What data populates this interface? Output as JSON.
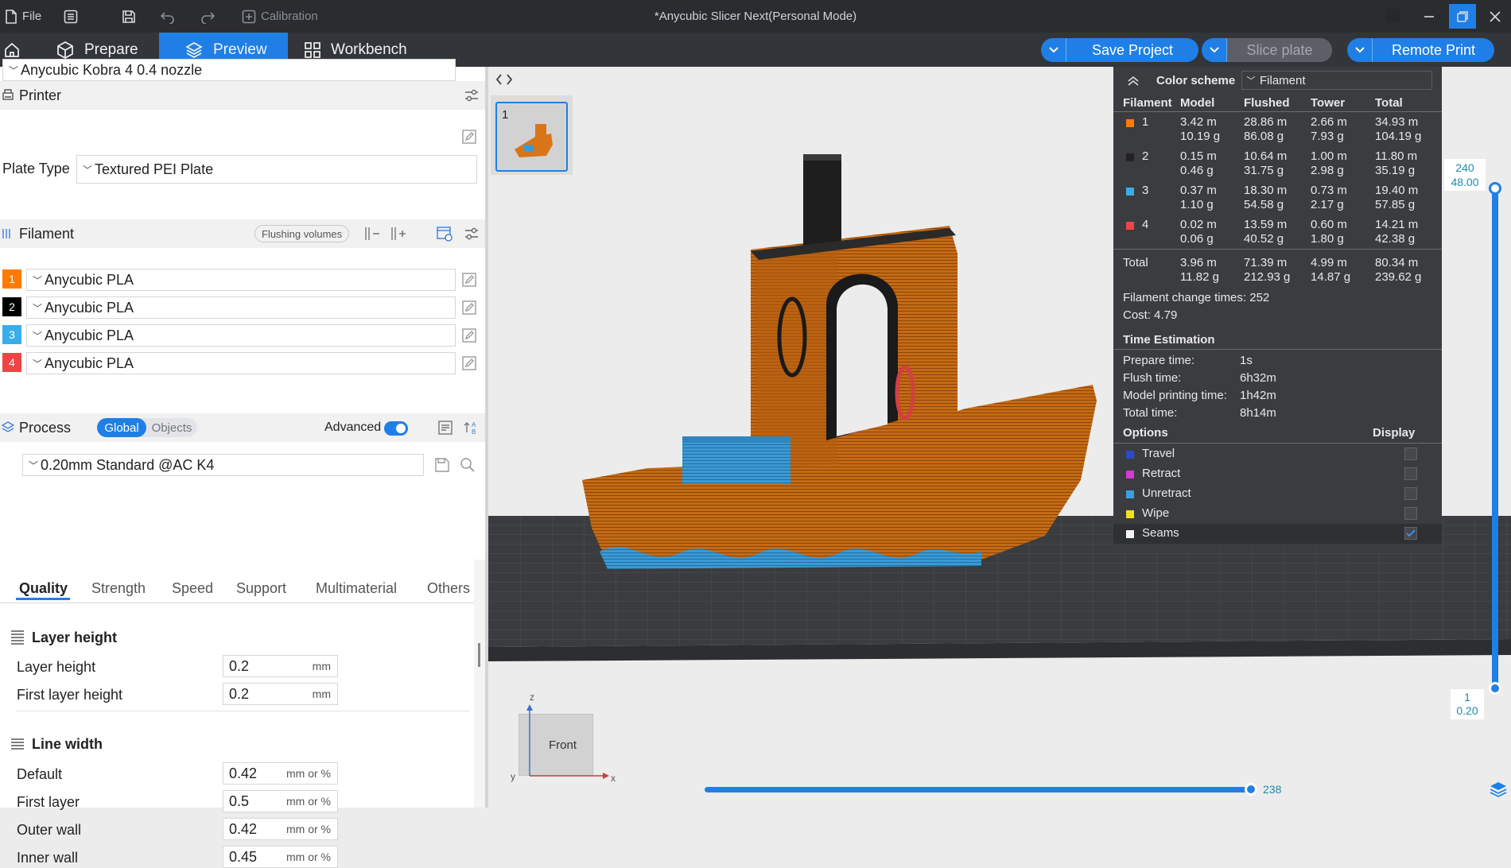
{
  "titlebar": {
    "file_label": "File",
    "calibration_label": "Calibration",
    "window_title": "*Anycubic Slicer Next(Personal Mode)"
  },
  "tabs": {
    "prepare": "Prepare",
    "preview": "Preview",
    "workbench": "Workbench",
    "save_project": "Save Project",
    "slice_plate": "Slice plate",
    "remote_print": "Remote Print"
  },
  "printer": {
    "section_title": "Printer",
    "printer_name": "Anycubic Kobra 4 0.4 nozzle",
    "plate_type_label": "Plate Type",
    "plate_type_value": "Textured PEI Plate"
  },
  "filament": {
    "section_title": "Filament",
    "flushing_volumes": "Flushing volumes",
    "items": [
      {
        "num": "1",
        "name": "Anycubic PLA",
        "color": "#ff7a00"
      },
      {
        "num": "2",
        "name": "Anycubic PLA",
        "color": "#000000"
      },
      {
        "num": "3",
        "name": "Anycubic PLA",
        "color": "#3aaee8"
      },
      {
        "num": "4",
        "name": "Anycubic PLA",
        "color": "#f04444"
      }
    ]
  },
  "process": {
    "section_title": "Process",
    "global_label": "Global",
    "objects_label": "Objects",
    "advanced_label": "Advanced",
    "profile": "0.20mm Standard @AC K4",
    "subtabs": [
      "Quality",
      "Strength",
      "Speed",
      "Support",
      "Multimaterial",
      "Others"
    ],
    "layer_height_group": "Layer height",
    "layer_height_label": "Layer height",
    "layer_height_value": "0.2",
    "first_layer_height_label": "First layer height",
    "first_layer_height_value": "0.2",
    "unit_mm": "mm",
    "line_width_group": "Line width",
    "unit_mm_or_pct": "mm or %",
    "line_widths": [
      {
        "label": "Default",
        "value": "0.42"
      },
      {
        "label": "First layer",
        "value": "0.5"
      },
      {
        "label": "Outer wall",
        "value": "0.42"
      },
      {
        "label": "Inner wall",
        "value": "0.45"
      }
    ]
  },
  "plate": {
    "thumb_number": "1"
  },
  "stats": {
    "color_scheme_label": "Color scheme",
    "color_scheme_value": "Filament",
    "headers": [
      "Filament",
      "Model",
      "Flushed",
      "Tower",
      "Total"
    ],
    "rows": [
      {
        "num": "1",
        "color": "#ff7a00",
        "model": [
          "3.42 m",
          "10.19 g"
        ],
        "flushed": [
          "28.86 m",
          "86.08 g"
        ],
        "tower": [
          "2.66 m",
          "7.93 g"
        ],
        "total": [
          "34.93 m",
          "104.19 g"
        ]
      },
      {
        "num": "2",
        "color": "#222222",
        "model": [
          "0.15 m",
          "0.46 g"
        ],
        "flushed": [
          "10.64 m",
          "31.75 g"
        ],
        "tower": [
          "1.00 m",
          "2.98 g"
        ],
        "total": [
          "11.80 m",
          "35.19 g"
        ]
      },
      {
        "num": "3",
        "color": "#3aaee8",
        "model": [
          "0.37 m",
          "1.10 g"
        ],
        "flushed": [
          "18.30 m",
          "54.58 g"
        ],
        "tower": [
          "0.73 m",
          "2.17 g"
        ],
        "total": [
          "19.40 m",
          "57.85 g"
        ]
      },
      {
        "num": "4",
        "color": "#f04444",
        "model": [
          "0.02 m",
          "0.06 g"
        ],
        "flushed": [
          "13.59 m",
          "40.52 g"
        ],
        "tower": [
          "0.60 m",
          "1.80 g"
        ],
        "total": [
          "14.21 m",
          "42.38 g"
        ]
      }
    ],
    "total_label": "Total",
    "total": {
      "model": [
        "3.96 m",
        "11.82 g"
      ],
      "flushed": [
        "71.39 m",
        "212.93 g"
      ],
      "tower": [
        "4.99 m",
        "14.87 g"
      ],
      "total": [
        "80.34 m",
        "239.62 g"
      ]
    },
    "change_times": "Filament change times:  252",
    "cost": "Cost:  4.79",
    "time_title": "Time Estimation",
    "times": [
      {
        "label": "Prepare time:",
        "value": "1s"
      },
      {
        "label": "Flush time:",
        "value": "6h32m"
      },
      {
        "label": "Model printing time:",
        "value": "1h42m"
      },
      {
        "label": "Total time:",
        "value": "8h14m"
      }
    ],
    "options_label": "Options",
    "display_label": "Display",
    "options": [
      {
        "label": "Travel",
        "color": "#2a4cc8",
        "checked": false
      },
      {
        "label": "Retract",
        "color": "#d23ad2",
        "checked": false
      },
      {
        "label": "Unretract",
        "color": "#3aa0e0",
        "checked": false
      },
      {
        "label": "Wipe",
        "color": "#f0e020",
        "checked": false
      },
      {
        "label": "Seams",
        "color": "#f4f4f4",
        "checked": true
      }
    ]
  },
  "slider": {
    "top_layer": "240",
    "top_height": "48.00",
    "bottom_layer": "1",
    "bottom_height": "0.20",
    "horizontal_value": "238"
  },
  "viewcube": {
    "front_label": "Front",
    "axis_z": "z",
    "axis_x": "x",
    "axis_y": "y"
  }
}
